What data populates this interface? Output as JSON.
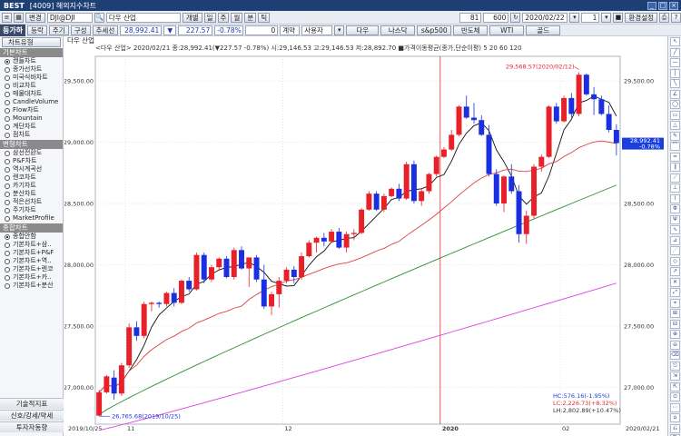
{
  "window": {
    "app": "BEST",
    "title": "[4009] 해외지수차트"
  },
  "toolbar1": {
    "change_btn": "변경",
    "code": "DJI@DJI",
    "name": "다우 산업",
    "period_buttons": [
      "개별",
      "일",
      "주",
      "월",
      "분",
      "틱"
    ],
    "count_a": "81",
    "count_b": "600",
    "date": "2020/02/22",
    "page_num": "1",
    "settings_btn": "환경설정"
  },
  "toolbar2": {
    "tab_label": "등가하",
    "price_label": "등락",
    "period_label": "주기",
    "struct_label": "구성",
    "add_label": "추세선",
    "price_value": "28,992.41",
    "change_value": "227.57",
    "change_pct": "-0.78%",
    "zero_value": "0",
    "jisu_label": "계약",
    "user_btn": "사용자",
    "index_buttons": [
      "다우",
      "나스닥",
      "s&p500",
      "반도체",
      "WTI",
      "골드"
    ]
  },
  "left_panel": {
    "top_btn": "차트유형",
    "sections": [
      {
        "title": "기본차트",
        "items": [
          {
            "label": "캔들차트",
            "on": true
          },
          {
            "label": "종가선차트",
            "on": false
          },
          {
            "label": "미국식바차트",
            "on": false
          },
          {
            "label": "비교차트",
            "on": false
          },
          {
            "label": "매물대차트",
            "on": false
          },
          {
            "label": "CandleVolume",
            "on": false
          },
          {
            "label": "Flow차트",
            "on": false
          },
          {
            "label": "Mountain",
            "on": false
          },
          {
            "label": "계단차트",
            "on": false
          },
          {
            "label": "점차트",
            "on": false
          }
        ]
      },
      {
        "title": "변형차트",
        "items": [
          {
            "label": "삼선전환도",
            "on": false
          },
          {
            "label": "P&F차트",
            "on": false
          },
          {
            "label": "역시계곡선",
            "on": false
          },
          {
            "label": "렌코차트",
            "on": false
          },
          {
            "label": "카기차트",
            "on": false
          },
          {
            "label": "분산차트",
            "on": false
          },
          {
            "label": "적은선차트",
            "on": false
          },
          {
            "label": "주기차트",
            "on": false
          },
          {
            "label": "MarketProfile",
            "on": false
          }
        ]
      },
      {
        "title": "종합차트",
        "items": [
          {
            "label": "종합안함",
            "on": true
          },
          {
            "label": "기본차트+삼..",
            "on": false
          },
          {
            "label": "기본차트+P&F",
            "on": false
          },
          {
            "label": "기본차트+역..",
            "on": false
          },
          {
            "label": "기본차트+렌코",
            "on": false
          },
          {
            "label": "기본차트+카..",
            "on": false
          },
          {
            "label": "기본차트+분산",
            "on": false
          }
        ]
      }
    ],
    "bottom_buttons": [
      "기술적지표",
      "신호/강세/약세",
      "투자자동향"
    ]
  },
  "chart_header": {
    "title": "다우 산업",
    "info": "<다우 산업> 2020/02/21 종:28,992.41(▼227.57 -0.78%) 시:29,146.53 고:29,146.53 저:28,892.70 ■가격이동평균(종가,단순이평) 5 20 60 120",
    "ma_periods": [
      "5",
      "20",
      "60",
      "120"
    ]
  },
  "annotations": {
    "high": "29,568.57(2020/02/12)",
    "low": "26,765.68(2019/10/25)",
    "current_price": "28,992.41",
    "current_pct": "-0.78%",
    "stats": [
      "HC:576.16(-1.95%)",
      "LC:2,226.73(+8.32%)",
      "LH:2,802.89(+10.47%)"
    ]
  },
  "colors": {
    "up": "#e8202a",
    "down": "#1a2fe0",
    "ma5": "#111111",
    "ma20": "#e04040",
    "ma60": "#2f8f2f",
    "ma120": "#e040e0",
    "titlebar": "#1e3f73"
  },
  "chart_data": {
    "type": "candlestick",
    "ylim": [
      26700,
      29700
    ],
    "yticks": [
      27000,
      27500,
      28000,
      28500,
      29000,
      29500
    ],
    "x_tick_labels": [
      "2019/10/25",
      "11",
      "12",
      "2020",
      "02",
      "2020/02/21"
    ],
    "candles": [
      [
        26770,
        26980,
        26765,
        26960
      ],
      [
        26960,
        27100,
        26950,
        27090
      ],
      [
        27080,
        27140,
        26900,
        26950
      ],
      [
        26950,
        27200,
        26930,
        27180
      ],
      [
        27180,
        27520,
        27160,
        27490
      ],
      [
        27490,
        27540,
        27380,
        27420
      ],
      [
        27420,
        27700,
        27400,
        27680
      ],
      [
        27680,
        27700,
        27620,
        27690
      ],
      [
        27690,
        27700,
        27650,
        27680
      ],
      [
        27680,
        27780,
        27660,
        27770
      ],
      [
        27770,
        27810,
        27660,
        27690
      ],
      [
        27690,
        27880,
        27680,
        27870
      ],
      [
        27870,
        27900,
        27780,
        27800
      ],
      [
        27800,
        28100,
        27790,
        28080
      ],
      [
        28080,
        28100,
        27850,
        27880
      ],
      [
        27880,
        28000,
        27860,
        27980
      ],
      [
        27980,
        28060,
        27960,
        28050
      ],
      [
        28050,
        28070,
        27890,
        27900
      ],
      [
        27900,
        28140,
        27880,
        28120
      ],
      [
        28120,
        28150,
        27960,
        27970
      ],
      [
        27970,
        28060,
        27820,
        28060
      ],
      [
        28060,
        28080,
        27860,
        27880
      ],
      [
        27880,
        28000,
        27640,
        27660
      ],
      [
        27660,
        27780,
        27590,
        27760
      ],
      [
        27760,
        27900,
        27650,
        27870
      ],
      [
        27870,
        27980,
        27850,
        27960
      ],
      [
        27960,
        27990,
        27850,
        27900
      ],
      [
        27900,
        28100,
        27880,
        28070
      ],
      [
        28070,
        28200,
        28060,
        28180
      ],
      [
        28180,
        28230,
        28100,
        28220
      ],
      [
        28220,
        28260,
        28150,
        28190
      ],
      [
        28190,
        28290,
        28180,
        28270
      ],
      [
        28270,
        28300,
        28130,
        28140
      ],
      [
        28140,
        28270,
        28100,
        28250
      ],
      [
        28250,
        28290,
        28200,
        28260
      ],
      [
        28260,
        28460,
        28250,
        28450
      ],
      [
        28450,
        28600,
        28440,
        28580
      ],
      [
        28580,
        28600,
        28440,
        28450
      ],
      [
        28450,
        28580,
        28430,
        28560
      ],
      [
        28560,
        28630,
        28550,
        28620
      ],
      [
        28620,
        28660,
        28520,
        28540
      ],
      [
        28540,
        28840,
        28530,
        28820
      ],
      [
        28820,
        28850,
        28500,
        28520
      ],
      [
        28520,
        28620,
        28480,
        28600
      ],
      [
        28600,
        28750,
        28580,
        28740
      ],
      [
        28740,
        28890,
        28720,
        28880
      ],
      [
        28880,
        28960,
        28870,
        28940
      ],
      [
        28940,
        29100,
        28930,
        29060
      ],
      [
        29060,
        29300,
        29050,
        29290
      ],
      [
        29290,
        29380,
        29190,
        29200
      ],
      [
        29200,
        29320,
        29150,
        29180
      ],
      [
        29180,
        29220,
        29050,
        29060
      ],
      [
        29060,
        29140,
        28720,
        28740
      ],
      [
        28740,
        28780,
        28480,
        28500
      ],
      [
        28500,
        28730,
        28430,
        28720
      ],
      [
        28720,
        28820,
        28580,
        28600
      ],
      [
        28600,
        28650,
        28180,
        28250
      ],
      [
        28250,
        28440,
        28170,
        28400
      ],
      [
        28400,
        28820,
        28380,
        28800
      ],
      [
        28800,
        28900,
        28760,
        28880
      ],
      [
        28880,
        29300,
        28870,
        29290
      ],
      [
        29290,
        29320,
        29150,
        29170
      ],
      [
        29170,
        29380,
        29160,
        29360
      ],
      [
        29360,
        29400,
        29200,
        29230
      ],
      [
        29230,
        29570,
        29210,
        29550
      ],
      [
        29550,
        29560,
        29380,
        29390
      ],
      [
        29390,
        29450,
        29220,
        29350
      ],
      [
        29350,
        29380,
        29220,
        29230
      ],
      [
        29230,
        29300,
        29080,
        29100
      ],
      [
        29100,
        29146,
        28892,
        28992
      ]
    ]
  }
}
